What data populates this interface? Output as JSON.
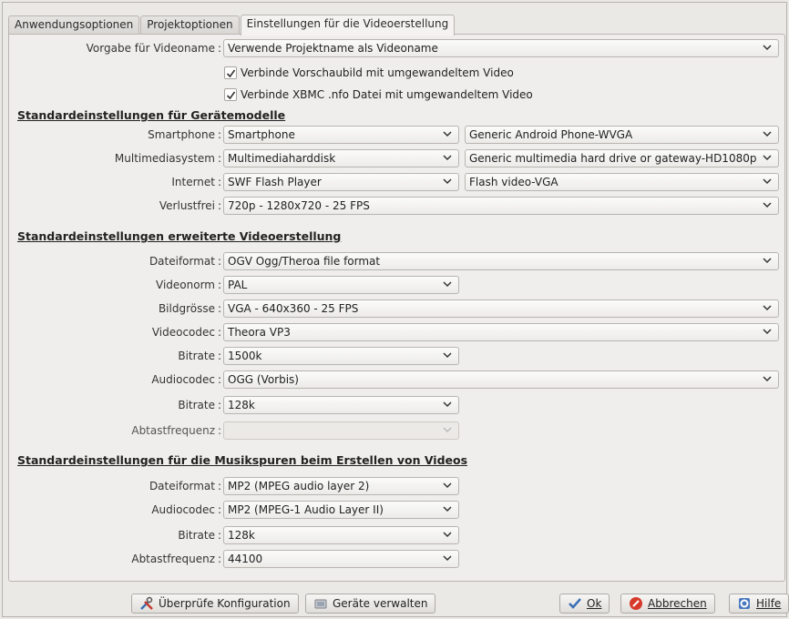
{
  "tabs": [
    {
      "label": "Anwendungsoptionen"
    },
    {
      "label": "Projektoptionen"
    },
    {
      "label": "Einstellungen für die Videoerstellung"
    }
  ],
  "video_name": {
    "label": "Vorgabe für Videoname",
    "value": "Verwende Projektname als Videoname"
  },
  "checkboxes": {
    "thumbnail": {
      "label": "Verbinde Vorschaubild mit umgewandeltem Video",
      "checked": true
    },
    "xbmc": {
      "label": "Verbinde XBMC .nfo Datei mit umgewandeltem Video",
      "checked": true
    }
  },
  "devices": {
    "heading": "Standardeinstellungen für Gerätemodelle",
    "smartphone": {
      "label": "Smartphone",
      "type": "Smartphone",
      "model": "Generic Android Phone-WVGA"
    },
    "multimedia": {
      "label": "Multimediasystem",
      "type": "Multimediaharddisk",
      "model": "Generic multimedia hard drive or gateway-HD1080p"
    },
    "internet": {
      "label": "Internet",
      "type": "SWF Flash Player",
      "model": "Flash video-VGA"
    },
    "lossless": {
      "label": "Verlustfrei",
      "value": "720p - 1280x720 - 25 FPS"
    }
  },
  "advanced": {
    "heading": "Standardeinstellungen erweiterte Videoerstellung",
    "file_format": {
      "label": "Dateiformat",
      "value": "OGV Ogg/Theroa file format"
    },
    "video_norm": {
      "label": "Videonorm",
      "value": "PAL"
    },
    "image_size": {
      "label": "Bildgrösse",
      "value": "VGA - 640x360 - 25 FPS"
    },
    "video_codec": {
      "label": "Videocodec",
      "value": "Theora VP3"
    },
    "video_bitrate": {
      "label": "Bitrate",
      "value": "1500k"
    },
    "audio_codec": {
      "label": "Audiocodec",
      "value": "OGG (Vorbis)"
    },
    "audio_bitrate": {
      "label": "Bitrate",
      "value": "128k"
    },
    "sample_rate": {
      "label": "Abtastfrequenz",
      "value": ""
    }
  },
  "music": {
    "heading": "Standardeinstellungen für die Musikspuren beim Erstellen von Videos",
    "file_format": {
      "label": "Dateiformat",
      "value": "MP2 (MPEG audio layer 2)"
    },
    "audio_codec": {
      "label": "Audiocodec",
      "value": "MP2 (MPEG-1 Audio Layer II)"
    },
    "bitrate": {
      "label": "Bitrate",
      "value": "128k"
    },
    "sample_rate": {
      "label": "Abtastfrequenz",
      "value": "44100"
    }
  },
  "buttons": {
    "check_config": "Überprüfe Konfiguration",
    "manage_devices": "Geräte verwalten",
    "ok": "Ok",
    "cancel": "Abbrechen",
    "help": "Hilfe"
  }
}
